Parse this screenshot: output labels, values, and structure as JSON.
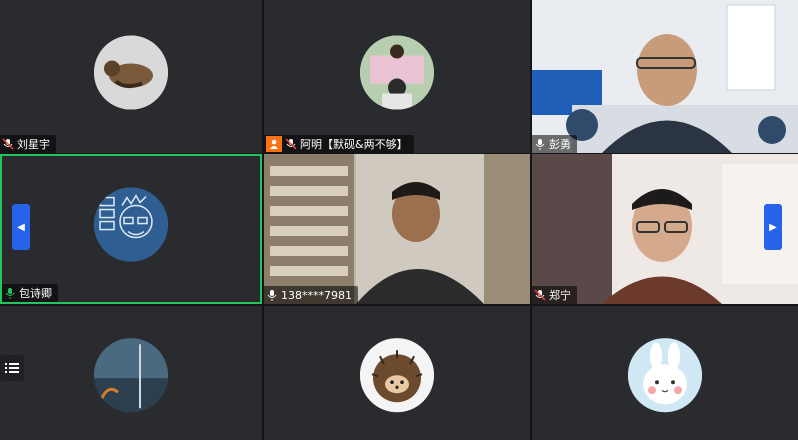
{
  "participants": [
    {
      "name": "刘星宇",
      "mic": "muted"
    },
    {
      "name": "阿明【默砚&两不够】",
      "mic": "muted",
      "host": true
    },
    {
      "name": "彭勇",
      "mic": "on"
    },
    {
      "name": "包诗卿",
      "mic": "active"
    },
    {
      "name": "138****7981",
      "mic": "on"
    },
    {
      "name": "郑宁",
      "mic": "muted"
    }
  ],
  "colors": {
    "tile_bg": "#2a2b2f",
    "active_border": "#22c55e",
    "nav_btn": "#2563eb",
    "host_badge": "#f97316"
  },
  "icons": [
    "mic-muted-icon",
    "mic-on-icon",
    "mic-active-icon",
    "host-icon",
    "chevron-left-icon",
    "chevron-right-icon",
    "list-icon"
  ]
}
